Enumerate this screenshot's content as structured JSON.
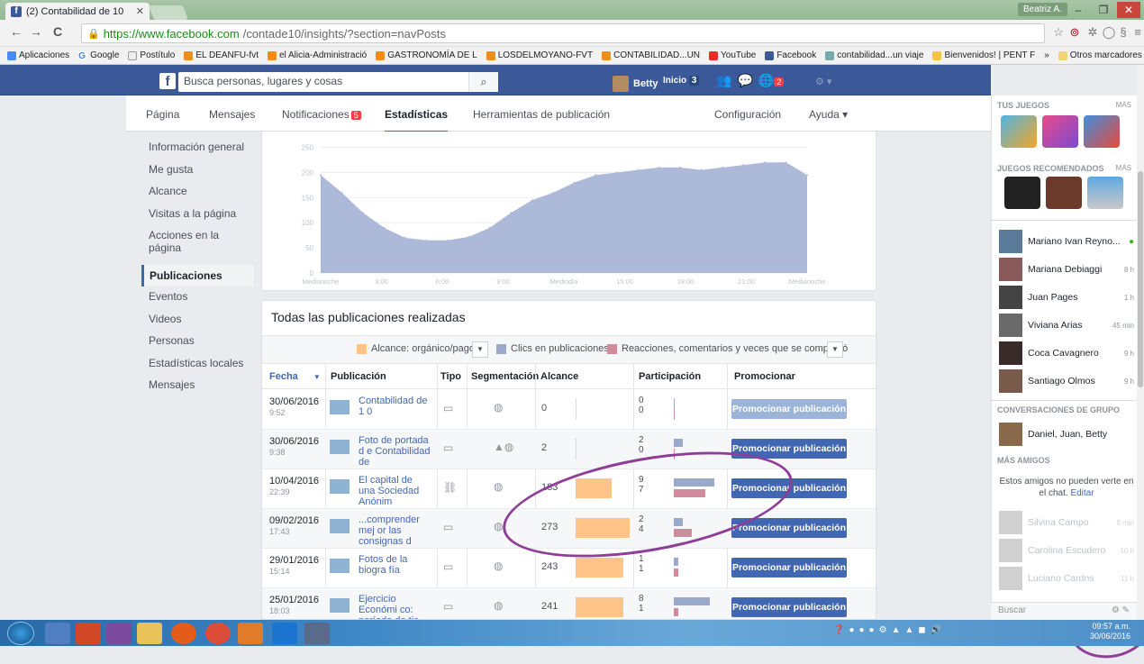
{
  "browser": {
    "tab_title": "(2) Contabilidad de 10",
    "user": "Beatriz A.",
    "url_secure": "https://www.facebook.com",
    "url_rest": "/contade10/insights/?section=navPosts",
    "bookmarks": [
      "Aplicaciones",
      "Google",
      "Postítulo",
      "EL DEANFU-fvt",
      "el Alicia-Administració",
      "GASTRONOMÍA DE L",
      "LOSDELMOYANO-FVT",
      "CONTABILIDAD...UN",
      "YouTube",
      "Facebook",
      "contabilidad...un viaje",
      "Bienvenidos! | PENT F",
      "»",
      "Otros marcadores"
    ]
  },
  "fb": {
    "search_placeholder": "Busca personas, lugares y cosas",
    "user_name": "Betty",
    "home_label": "Inicio",
    "home_count": "3",
    "notif_count": "2"
  },
  "page_tabs": {
    "pagina": "Página",
    "mensajes": "Mensajes",
    "notificaciones": "Notificaciones",
    "notif_badge": "5",
    "estadisticas": "Estadísticas",
    "herramientas": "Herramientas de publicación",
    "configuracion": "Configuración",
    "ayuda": "Ayuda ▾"
  },
  "left_menu": [
    "Información general",
    "Me gusta",
    "Alcance",
    "Visitas a la página",
    "Acciones en la página",
    "Publicaciones",
    "Eventos",
    "Videos",
    "Personas",
    "Estadísticas locales",
    "Mensajes"
  ],
  "chart_data": {
    "type": "area",
    "categories": [
      "Medianoche",
      "3:00",
      "6:00",
      "9:00",
      "Mediodía",
      "15:00",
      "18:00",
      "21:00",
      "Medianoche"
    ],
    "x": [
      0,
      1,
      2,
      3,
      4,
      5,
      6,
      7,
      8,
      9,
      10,
      11,
      12,
      13,
      14,
      15,
      16,
      17,
      18,
      19,
      20,
      21,
      22,
      23
    ],
    "values": [
      195,
      160,
      120,
      90,
      70,
      65,
      65,
      72,
      90,
      120,
      145,
      160,
      180,
      195,
      200,
      205,
      210,
      210,
      205,
      210,
      215,
      220,
      220,
      195
    ],
    "yticks": [
      "0",
      "50",
      "100",
      "150",
      "200",
      "250"
    ],
    "ylim": [
      0,
      260
    ],
    "color": "#adb9d8",
    "grid": true
  },
  "posts": {
    "title": "Todas las publicaciones realizadas",
    "legend_alcance": "Alcance: orgánico/pago",
    "legend_clics": "Clics en publicaciones",
    "legend_reacciones": "Reacciones, comentarios y veces que se compartió",
    "columns": {
      "fecha": "Fecha",
      "publicacion": "Publicación",
      "tipo": "Tipo",
      "segmentacion": "Segmentación",
      "alcance": "Alcance",
      "participacion": "Participación",
      "promocionar": "Promocionar"
    },
    "rows": [
      {
        "date": "30/06/2016",
        "time": "9:52",
        "text": "Contabilidad de 1 0",
        "reach": "0",
        "p1": "0",
        "p2": "0",
        "promo": "Promocionar publicación",
        "reach_frac": 0,
        "c1": 0,
        "c2": 0
      },
      {
        "date": "30/06/2016",
        "time": "9:38",
        "text": "Foto de portada d e Contabilidad de",
        "reach": "2",
        "p1": "2",
        "p2": "0",
        "promo": "Promocionar publicación",
        "reach_frac": 0,
        "c1": 0.2,
        "c2": 0
      },
      {
        "date": "10/04/2016",
        "time": "22:39",
        "text": "El capital de una Sociedad Anónim",
        "reach": "183",
        "p1": "9",
        "p2": "7",
        "promo": "Promocionar publicación",
        "reach_frac": 0.67,
        "c1": 0.9,
        "c2": 0.7
      },
      {
        "date": "09/02/2016",
        "time": "17:43",
        "text": "...comprender mej or las consignas d",
        "reach": "273",
        "p1": "2",
        "p2": "4",
        "promo": "Promocionar publicación",
        "reach_frac": 1,
        "c1": 0.2,
        "c2": 0.4
      },
      {
        "date": "29/01/2016",
        "time": "15:14",
        "text": "Fotos de la biogra fía",
        "reach": "243",
        "p1": "1",
        "p2": "1",
        "promo": "Promocionar publicación",
        "reach_frac": 0.89,
        "c1": 0.1,
        "c2": 0.1
      },
      {
        "date": "25/01/2016",
        "time": "18:03",
        "text": "Ejercicio Económi co: período de tie",
        "reach": "241",
        "p1": "8",
        "p2": "1",
        "promo": "Promocionar publicación",
        "reach_frac": 0.88,
        "c1": 0.8,
        "c2": 0.1
      }
    ]
  },
  "sidebar": {
    "tus_juegos": "TUS JUEGOS",
    "mas": "MÁS",
    "recomendados": "JUEGOS RECOMENDADOS",
    "contacts": [
      {
        "name": "Mariano Ivan Reyno...",
        "time": "●"
      },
      {
        "name": "Mariana Debiaggi",
        "time": "8 h"
      },
      {
        "name": "Juan Pages",
        "time": "1 h"
      },
      {
        "name": "Viviana Arias",
        "time": "45 min"
      },
      {
        "name": "Coca Cavagnero",
        "time": "9 h"
      },
      {
        "name": "Santiago Olmos",
        "time": "9 h"
      }
    ],
    "grupo_hdr": "CONVERSACIONES DE GRUPO",
    "grupo": "Daniel, Juan, Betty",
    "mas_amigos": "MÁS AMIGOS",
    "no_chat": "Estos amigos no pueden verte en el chat.",
    "editar": "Editar",
    "faded": [
      {
        "name": "Silvina Campo",
        "time": "9 min"
      },
      {
        "name": "Carolina Escudero",
        "time": "10 h"
      },
      {
        "name": "Luciano Cardns",
        "time": "11 h"
      }
    ],
    "search": "Buscar"
  },
  "taskbar": {
    "time": "09:57 a.m.",
    "date": "30/06/2016"
  }
}
